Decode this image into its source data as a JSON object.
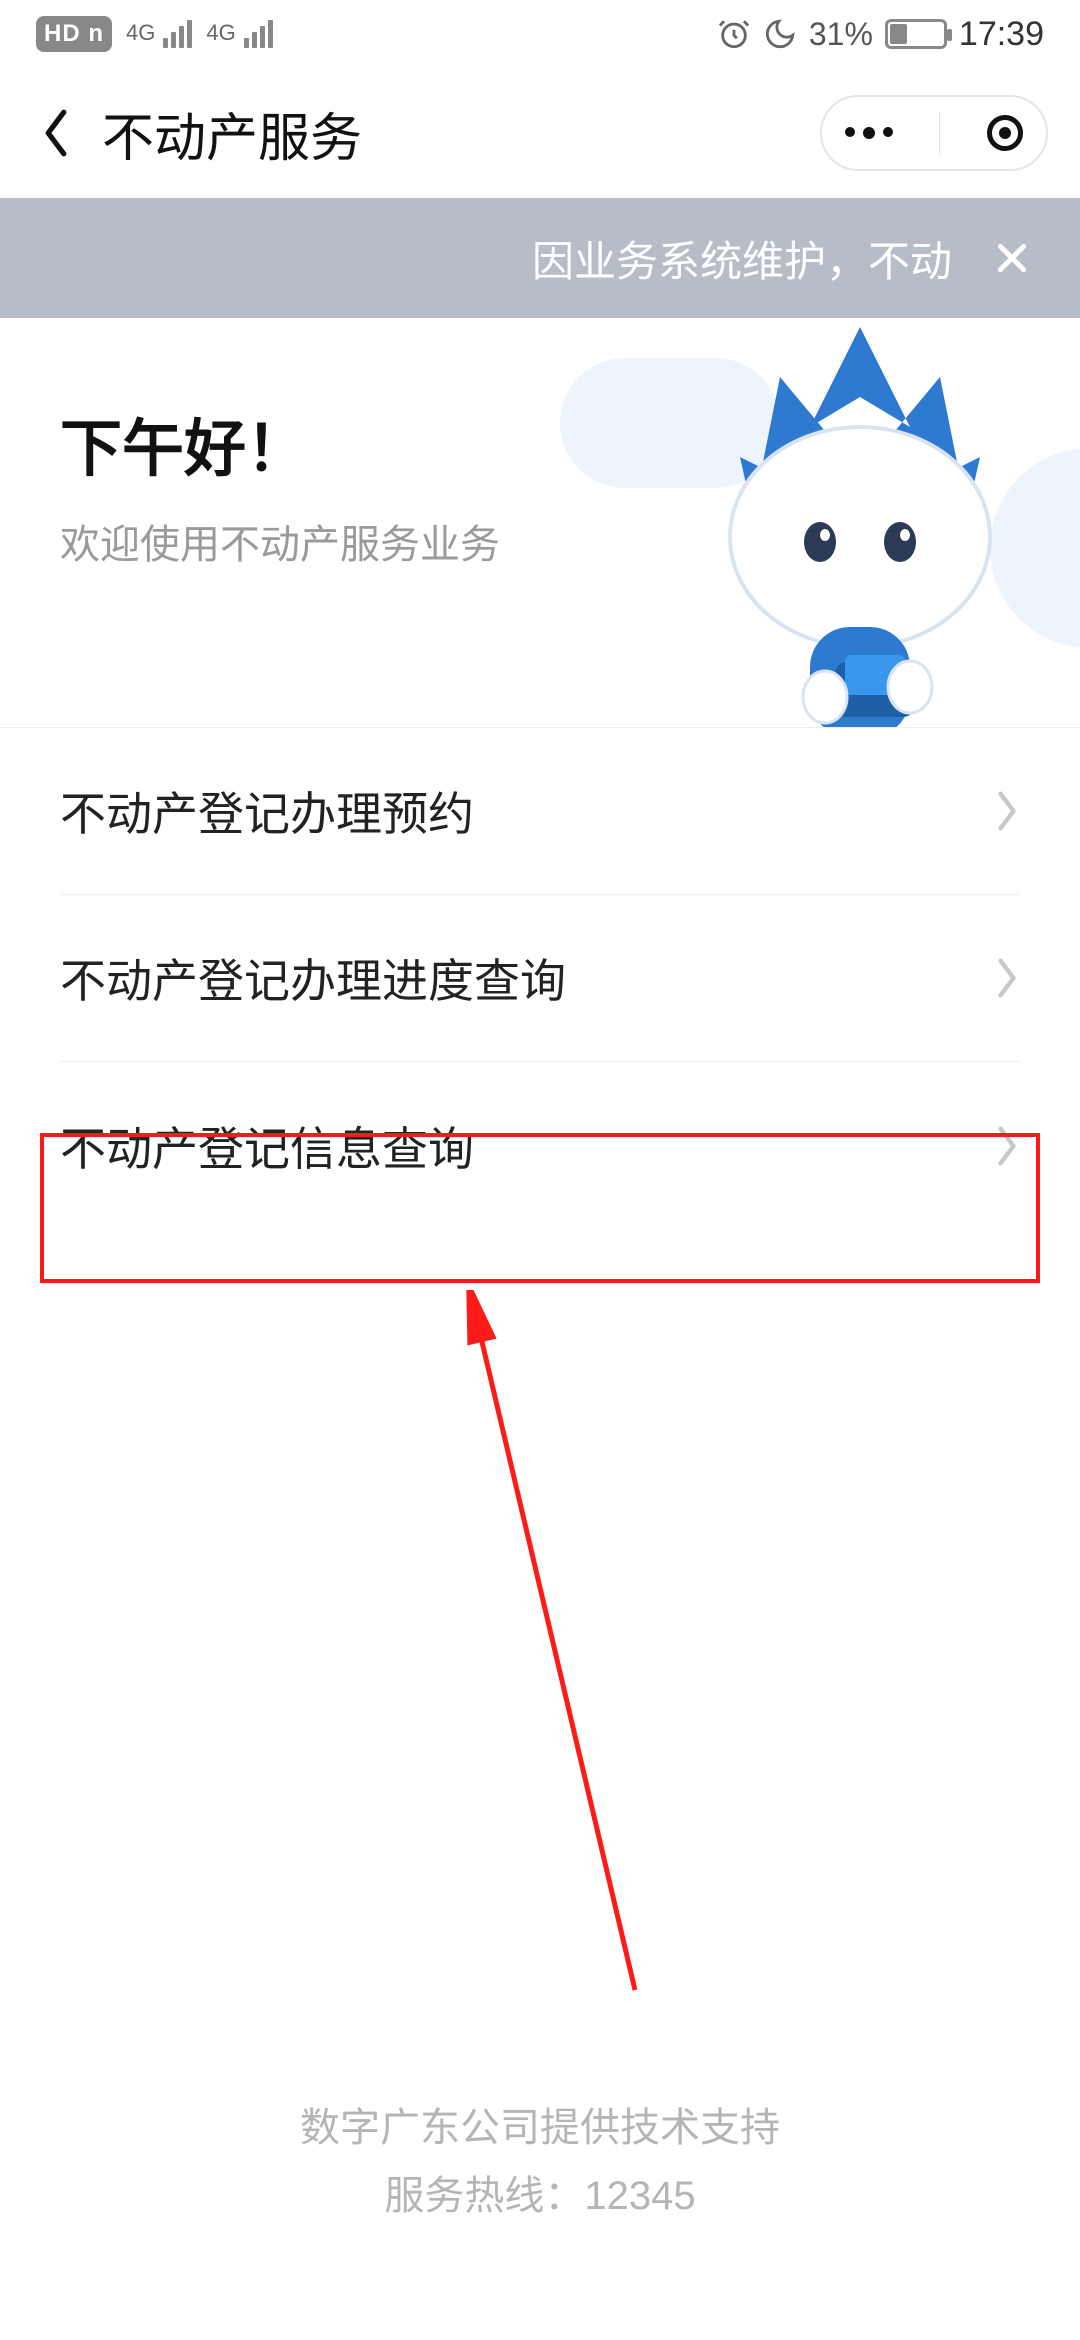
{
  "status_bar": {
    "hd_label": "HD n",
    "signal1_label": "4G",
    "signal2_label": "4G",
    "battery_percent": "31%",
    "time": "17:39"
  },
  "header": {
    "title": "不动产服务"
  },
  "notice": {
    "text": "因业务系统维护，不动"
  },
  "hero": {
    "greeting": "下午好！",
    "subtitle": "欢迎使用不动产服务业务"
  },
  "menu": {
    "items": [
      {
        "label": "不动产登记办理预约"
      },
      {
        "label": "不动产登记办理进度查询"
      },
      {
        "label": "不动产登记信息查询"
      }
    ],
    "highlighted_index": 2
  },
  "footer": {
    "line1": "数字广东公司提供技术支持",
    "line2": "服务热线：12345"
  },
  "annotation": {
    "highlight_color": "#ff1a1a"
  }
}
